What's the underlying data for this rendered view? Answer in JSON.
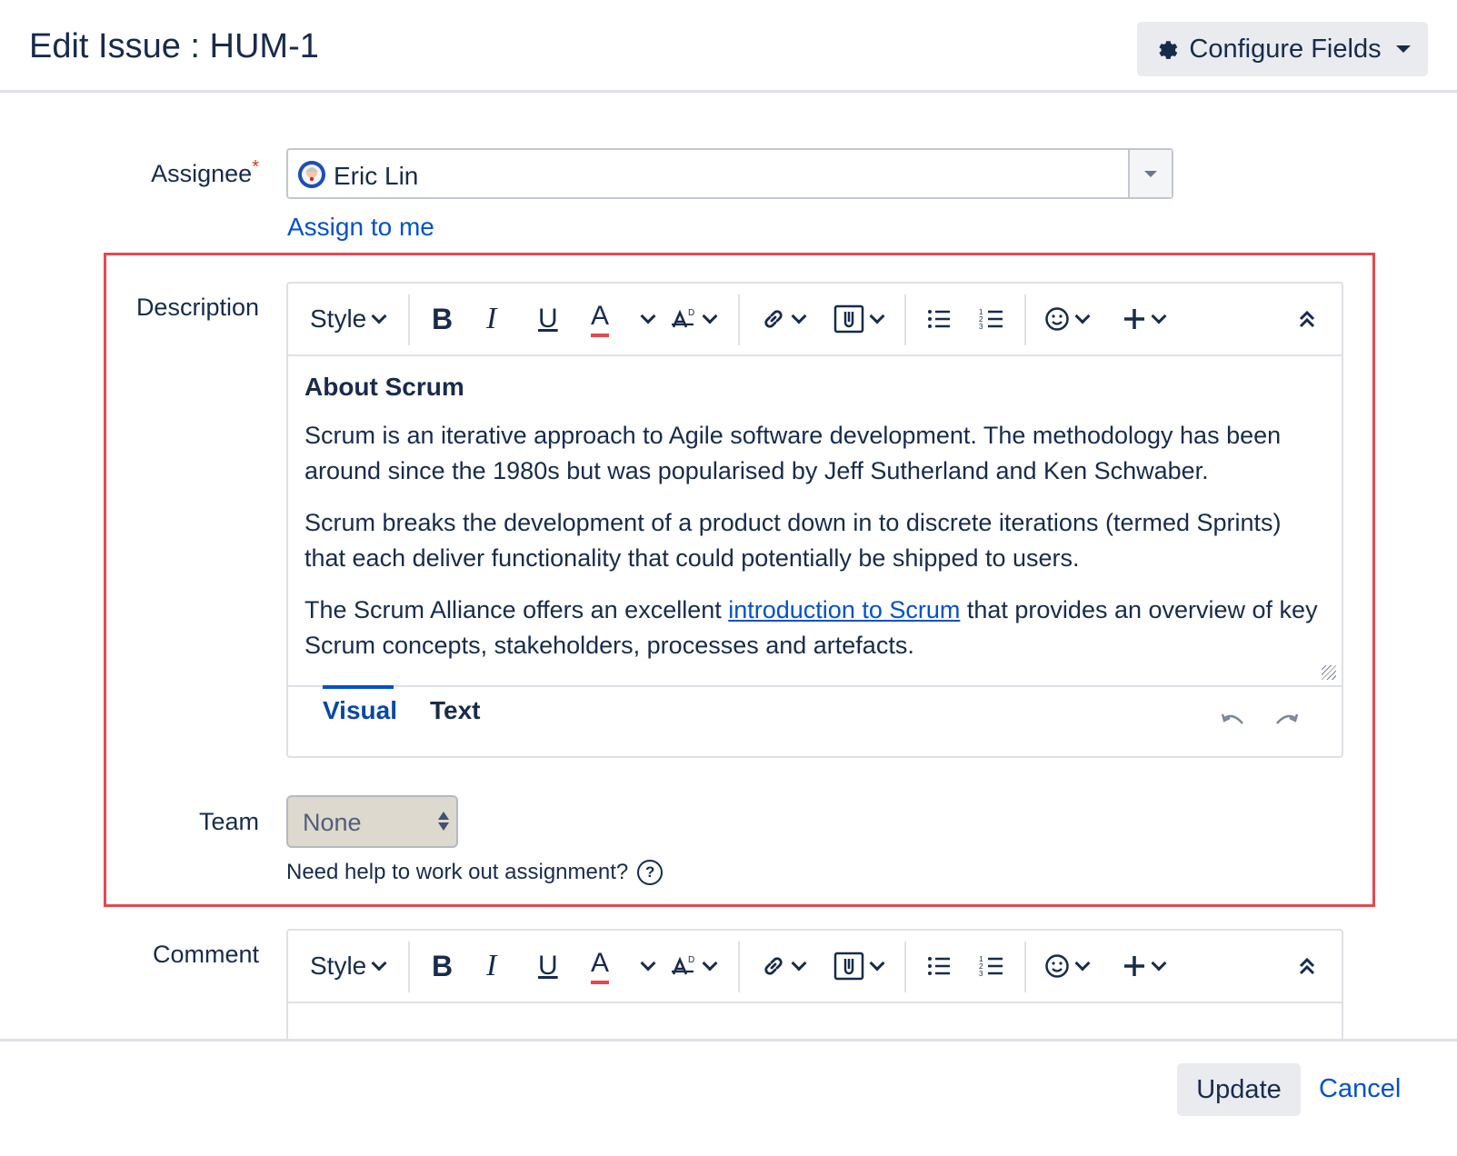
{
  "header": {
    "title": "Edit Issue : HUM-1",
    "configure_label": "Configure Fields"
  },
  "assignee": {
    "label": "Assignee",
    "required_mark": "*",
    "value": "Eric Lin",
    "assign_to_me": "Assign to me"
  },
  "toolbar": {
    "style_label": "Style",
    "bold": "B",
    "italic": "I",
    "underline": "U",
    "text_color": "A",
    "icons": [
      "chevron-down-icon",
      "text-effects-icon",
      "link-icon",
      "attachment-icon",
      "bullet-list-icon",
      "numbered-list-icon",
      "emoji-icon",
      "insert-plus-icon",
      "collapse-icon"
    ]
  },
  "description": {
    "label": "Description",
    "heading": "About Scrum",
    "p1": "Scrum is an iterative approach to Agile software development. The methodology has been around since the 1980s but was popularised by Jeff Sutherland and Ken Schwaber.",
    "p2": "Scrum breaks the development of a product down in to discrete iterations (termed Sprints) that each deliver functionality that could potentially be shipped to users.",
    "p3_before": "The Scrum Alliance offers an excellent ",
    "p3_link": "introduction to Scrum",
    "p3_after": " that provides an overview of key Scrum concepts, stakeholders, processes and artefacts.",
    "tab_visual": "Visual",
    "tab_text": "Text"
  },
  "team": {
    "label": "Team",
    "value": "None",
    "help": "Need help to work out assignment?",
    "help_icon": "?"
  },
  "comment": {
    "label": "Comment"
  },
  "footer": {
    "update": "Update",
    "cancel": "Cancel"
  },
  "colors": {
    "link": "#0052cc",
    "highlight_box": "#e5484d",
    "button_bg": "#e9ebee",
    "text": "#172b4d"
  }
}
